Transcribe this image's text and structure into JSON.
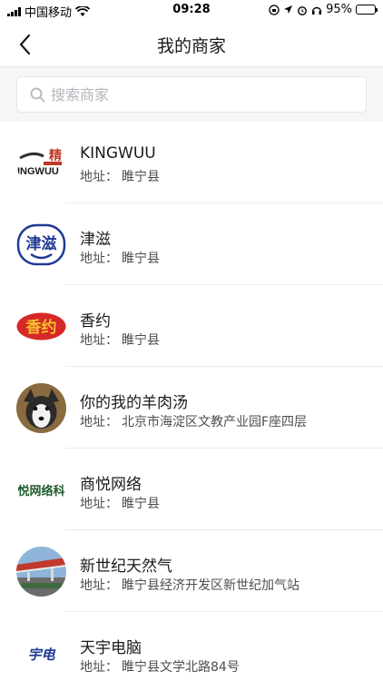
{
  "status_bar": {
    "carrier": "中国移动",
    "time": "09:28",
    "battery": "95%",
    "battery_level": 0.95
  },
  "nav": {
    "title": "我的商家",
    "back_icon": "chevron-left-icon"
  },
  "search": {
    "placeholder": "搜索商家",
    "value": ""
  },
  "merchants": [
    {
      "name": "KINGWUU",
      "address_label": "地址：",
      "address": "睢宁县",
      "logo": "kingwuu-logo",
      "logo_text": "INGWUU"
    },
    {
      "name": "津滋",
      "address_label": "地址：",
      "address": "睢宁县",
      "logo": "jinzi-logo",
      "logo_text": "津滋"
    },
    {
      "name": "香约",
      "address_label": "地址：",
      "address": "睢宁县",
      "logo": "xiangyue-logo",
      "logo_text": "香约"
    },
    {
      "name": "你的我的羊肉汤",
      "address_label": "地址：",
      "address": "北京市海淀区文教产业园F座四层",
      "logo": "dog-photo-avatar",
      "logo_text": ""
    },
    {
      "name": "商悦网络",
      "address_label": "地址：",
      "address": "睢宁县",
      "logo": "shangyue-logo",
      "logo_text": "悦网络科"
    },
    {
      "name": "新世纪天然气",
      "address_label": "地址：",
      "address": "睢宁县经济开发区新世纪加气站",
      "logo": "gas-station-photo",
      "logo_text": ""
    },
    {
      "name": "天宇电脑",
      "address_label": "地址：",
      "address": "睢宁县文学北路84号",
      "logo": "tianyu-logo",
      "logo_text": "宇电"
    }
  ]
}
